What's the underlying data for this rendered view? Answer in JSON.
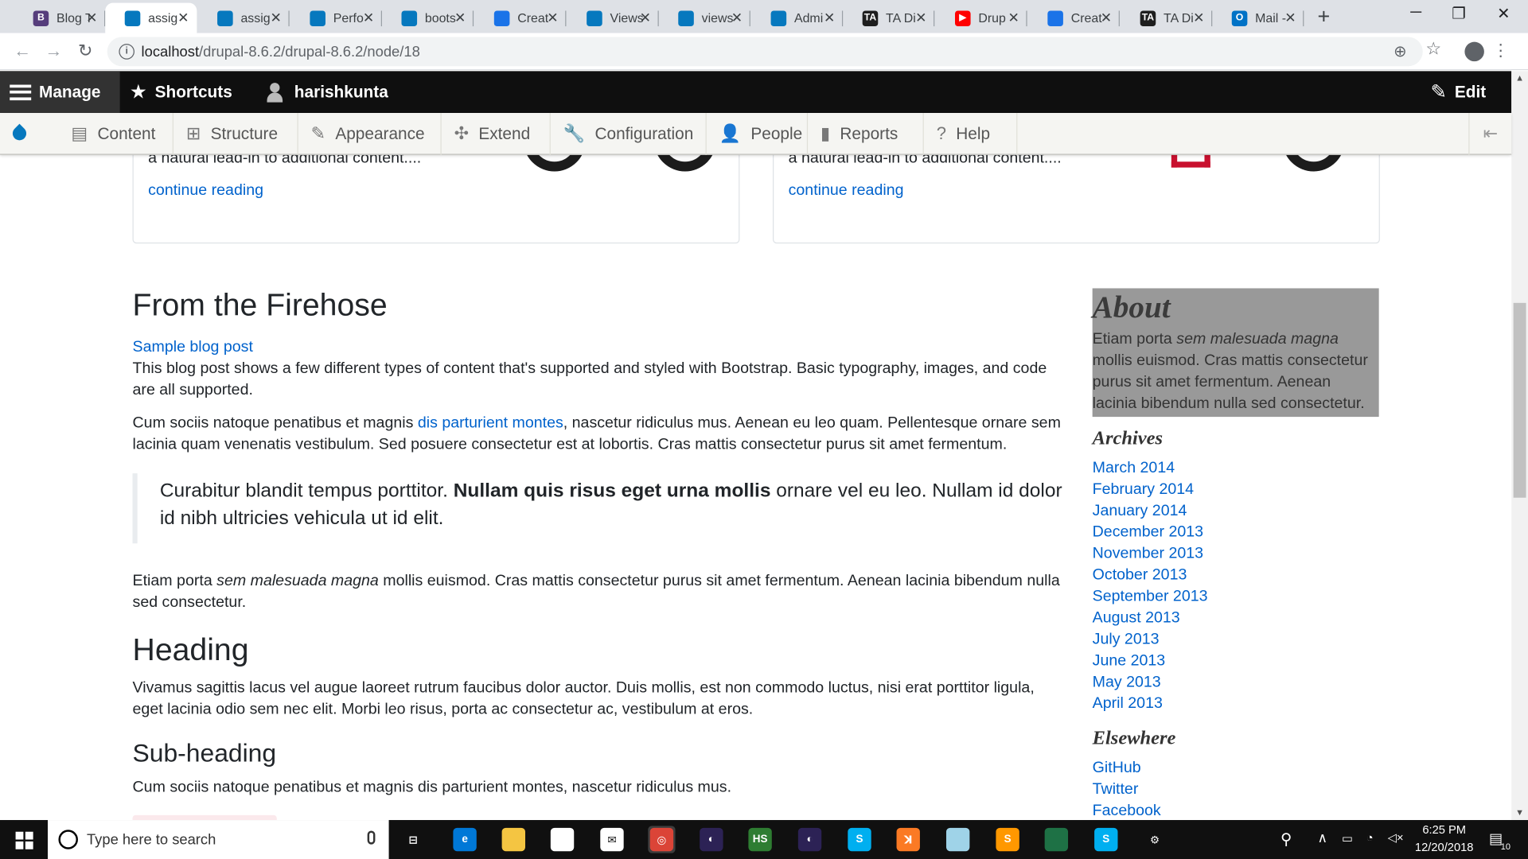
{
  "browser": {
    "tabs": [
      {
        "title": "Blog T",
        "favicon": "bootstrap-b-icon",
        "color": "#563d7c",
        "letter": "B"
      },
      {
        "title": "assig",
        "favicon": "drupal-drop-icon",
        "color": "#0678be",
        "letter": ""
      },
      {
        "title": "assig",
        "favicon": "drupal-drop-icon",
        "color": "#0678be",
        "letter": ""
      },
      {
        "title": "Perfo",
        "favicon": "drupal-drop-icon",
        "color": "#0678be",
        "letter": ""
      },
      {
        "title": "boots",
        "favicon": "drupal-drop-icon",
        "color": "#0678be",
        "letter": ""
      },
      {
        "title": "Creat",
        "favicon": "star-badge-icon",
        "color": "#1a73e8",
        "letter": ""
      },
      {
        "title": "Views",
        "favicon": "drupal-drop-icon",
        "color": "#0678be",
        "letter": ""
      },
      {
        "title": "views",
        "favicon": "drupal-drop-icon",
        "color": "#0678be",
        "letter": ""
      },
      {
        "title": "Admi",
        "favicon": "drupal-drop-icon",
        "color": "#0678be",
        "letter": ""
      },
      {
        "title": "TA Di",
        "favicon": "ta-logo-icon",
        "color": "#1e1e1e",
        "letter": "TA"
      },
      {
        "title": "Drup",
        "favicon": "youtube-icon",
        "color": "#ff0000",
        "letter": "▶"
      },
      {
        "title": "Creat",
        "favicon": "star-badge-icon",
        "color": "#1a73e8",
        "letter": ""
      },
      {
        "title": "TA Di",
        "favicon": "ta-logo-icon",
        "color": "#1e1e1e",
        "letter": "TA"
      },
      {
        "title": "Mail -",
        "favicon": "outlook-icon",
        "color": "#0072c6",
        "letter": "O"
      }
    ],
    "active_tab_index": 1,
    "url_host": "localhost",
    "url_path": "/drupal-8.6.2/drupal-8.6.2/node/18"
  },
  "toolbar": {
    "manage": "Manage",
    "shortcuts": "Shortcuts",
    "user": "harishkunta",
    "edit": "Edit"
  },
  "tray": {
    "items": [
      {
        "label": "Content",
        "icon": "document-icon"
      },
      {
        "label": "Structure",
        "icon": "sitemap-icon"
      },
      {
        "label": "Appearance",
        "icon": "paintbrush-icon"
      },
      {
        "label": "Extend",
        "icon": "puzzle-icon"
      },
      {
        "label": "Configuration",
        "icon": "wrench-icon"
      },
      {
        "label": "People",
        "icon": "people-icon"
      },
      {
        "label": "Reports",
        "icon": "bar-chart-icon"
      },
      {
        "label": "Help",
        "icon": "help-icon"
      }
    ]
  },
  "cards": [
    {
      "text": "This is a wider card with supporting text below as a natural lead-in to additional content....",
      "link": "continue reading"
    },
    {
      "text": "This is a wider card with supporting text below as a natural lead-in to additional content....",
      "link": "continue reading"
    }
  ],
  "main": {
    "heading": "From the Firehose",
    "post_link": "Sample blog post",
    "intro": "This blog post shows a few different types of content that's supported and styled with Bootstrap. Basic typography, images, and code are all supported.",
    "p2_before": "Cum sociis natoque penatibus et magnis ",
    "p2_link": "dis parturient montes",
    "p2_after": ", nascetur ridiculus mus. Aenean eu leo quam. Pellentesque ornare sem lacinia quam venenatis vestibulum. Sed posuere consectetur est at lobortis. Cras mattis consectetur purus sit amet fermentum.",
    "quote_before": "Curabitur blandit tempus porttitor. ",
    "quote_bold": "Nullam quis risus eget urna mollis",
    "quote_after": " ornare vel eu leo. Nullam id dolor id nibh ultricies vehicula ut id elit.",
    "p3_before": "Etiam porta ",
    "p3_em": "sem malesuada magna",
    "p3_after": " mollis euismod. Cras mattis consectetur purus sit amet fermentum. Aenean lacinia bibendum nulla sed consectetur.",
    "heading2": "Heading",
    "p4": "Vivamus sagittis lacus vel augue laoreet rutrum faucibus dolor auctor. Duis mollis, est non commodo luctus, nisi erat porttitor ligula, eget lacinia odio sem nec elit. Morbi leo risus, porta ac consectetur ac, vestibulum at eros.",
    "subheading": "Sub-heading",
    "p5": "Cum sociis natoque penatibus et magnis dis parturient montes, nascetur ridiculus mus."
  },
  "sidebar": {
    "about_title": "About",
    "about_before": "Etiam porta ",
    "about_em": "sem malesuada magna",
    "about_after": " mollis euismod. Cras mattis consectetur purus sit amet fermentum. Aenean lacinia bibendum nulla sed consectetur.",
    "archives_title": "Archives",
    "archives": [
      "March 2014",
      "February 2014",
      "January 2014",
      "December 2013",
      "November 2013",
      "October 2013",
      "September 2013",
      "August 2013",
      "July 2013",
      "June 2013",
      "May 2013",
      "April 2013"
    ],
    "elsewhere_title": "Elsewhere",
    "elsewhere": [
      "GitHub",
      "Twitter",
      "Facebook"
    ]
  },
  "taskbar": {
    "search_placeholder": "Type here to search",
    "time": "6:25 PM",
    "date": "12/20/2018",
    "notification_count": "10",
    "apps": [
      {
        "name": "task-view-icon",
        "color": "#101010",
        "label": "⊟"
      },
      {
        "name": "edge-icon",
        "color": "#0078d7",
        "label": "e"
      },
      {
        "name": "file-explorer-icon",
        "color": "#f4c542",
        "label": ""
      },
      {
        "name": "store-icon",
        "color": "#ffffff",
        "label": ""
      },
      {
        "name": "mail-icon",
        "color": "#ffffff",
        "label": "✉"
      },
      {
        "name": "chrome-icon",
        "color": "#db4437",
        "label": "◎"
      },
      {
        "name": "eclipse-icon",
        "color": "#2c2255",
        "label": "◐"
      },
      {
        "name": "hs-app-icon",
        "color": "#2e7d32",
        "label": "HS"
      },
      {
        "name": "eclipse-icon-2",
        "color": "#2c2255",
        "label": "◐"
      },
      {
        "name": "skype-icon",
        "color": "#00aff0",
        "label": "S"
      },
      {
        "name": "xampp-icon",
        "color": "#fb7a24",
        "label": "ꓘ"
      },
      {
        "name": "notepad-icon",
        "color": "#9fd3e8",
        "label": ""
      },
      {
        "name": "sublime-icon",
        "color": "#ff9800",
        "label": "S"
      },
      {
        "name": "excel-like-icon",
        "color": "#1e7145",
        "label": ""
      },
      {
        "name": "skype-icon-2",
        "color": "#00aff0",
        "label": "S"
      },
      {
        "name": "settings-gear-icon",
        "color": "#101010",
        "label": "⚙"
      }
    ]
  }
}
